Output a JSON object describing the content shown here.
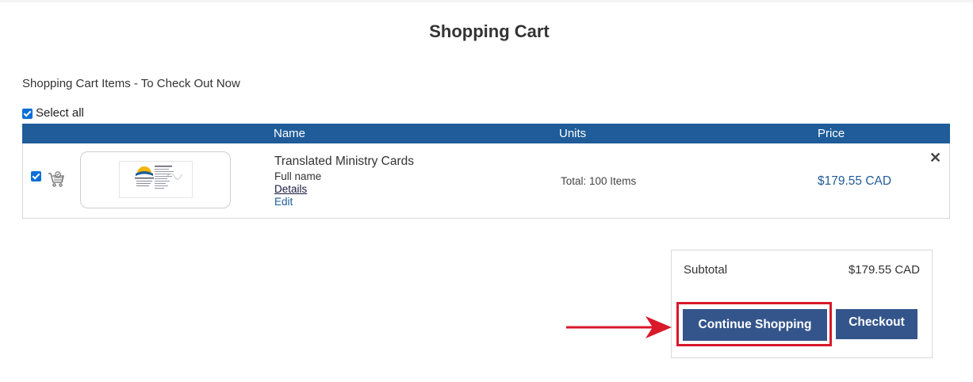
{
  "page": {
    "title": "Shopping Cart",
    "section_title": "Shopping Cart Items - To Check Out Now",
    "select_all_label": "Select all"
  },
  "table": {
    "headers": {
      "name": "Name",
      "units": "Units",
      "price": "Price"
    },
    "items": [
      {
        "selected": true,
        "name": "Translated Ministry Cards",
        "subtitle": "Full name",
        "details_link": "Details",
        "edit_link": "Edit",
        "units": "Total: 100 Items",
        "price": "$179.55 CAD"
      }
    ]
  },
  "summary": {
    "subtotal_label": "Subtotal",
    "subtotal_value": "$179.55 CAD",
    "continue_label": "Continue Shopping",
    "checkout_label": "Checkout"
  },
  "colors": {
    "header_bar": "#1f5c99",
    "button": "#34558b",
    "price_text": "#1f5c99",
    "highlight": "#d9182a"
  },
  "icons": [
    "checkbox-icon",
    "cart-icon",
    "close-icon",
    "arrow-right-icon"
  ]
}
